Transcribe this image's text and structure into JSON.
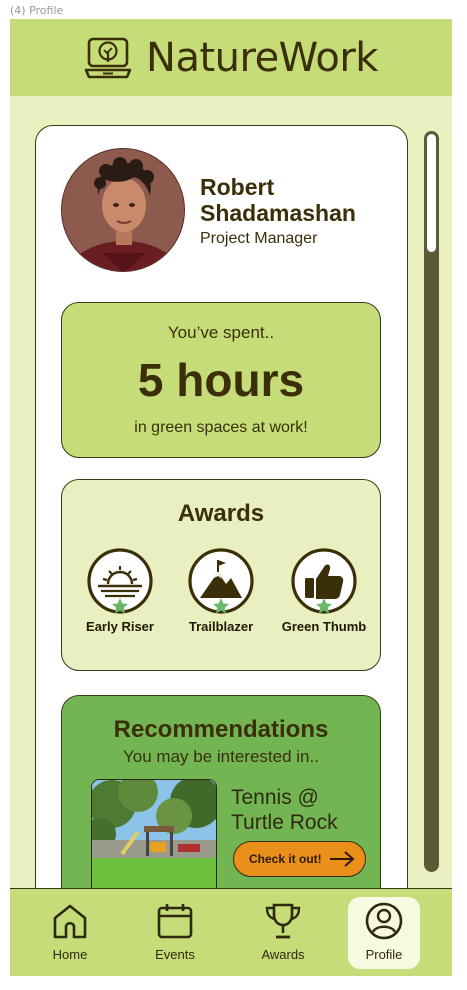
{
  "frame_label": "(4) Profile",
  "header": {
    "title": "NatureWork",
    "logo_icon": "laptop-tree-icon"
  },
  "profile": {
    "name": "Robert Shadamashan",
    "role": "Project Manager"
  },
  "stats": {
    "pre_text": "You’ve spent..",
    "value_text": "5 hours",
    "post_text": "in green spaces at work!"
  },
  "awards": {
    "title": "Awards",
    "items": [
      {
        "label": "Early Riser",
        "icon": "sunrise-icon"
      },
      {
        "label": "Trailblazer",
        "icon": "mountain-flag-icon"
      },
      {
        "label": "Green Thumb",
        "icon": "thumbs-up-icon"
      }
    ]
  },
  "recommendations": {
    "title": "Recommendations",
    "subtitle": "You may be interested in..",
    "item": {
      "title": "Tennis @ Turtle Rock",
      "button_label": "Check it out!"
    }
  },
  "scroll": {
    "position_fraction": 0.0
  },
  "nav": {
    "items": [
      {
        "label": "Home",
        "icon": "home-icon"
      },
      {
        "label": "Events",
        "icon": "calendar-icon"
      },
      {
        "label": "Awards",
        "icon": "trophy-icon"
      },
      {
        "label": "Profile",
        "icon": "user-icon"
      }
    ],
    "active": "Profile"
  },
  "colors": {
    "header": "#c6dc78",
    "background": "#e9efbf",
    "recommendations": "#72b552",
    "button": "#e98f1a",
    "text": "#3a2f08",
    "star": "#6ab86a"
  }
}
